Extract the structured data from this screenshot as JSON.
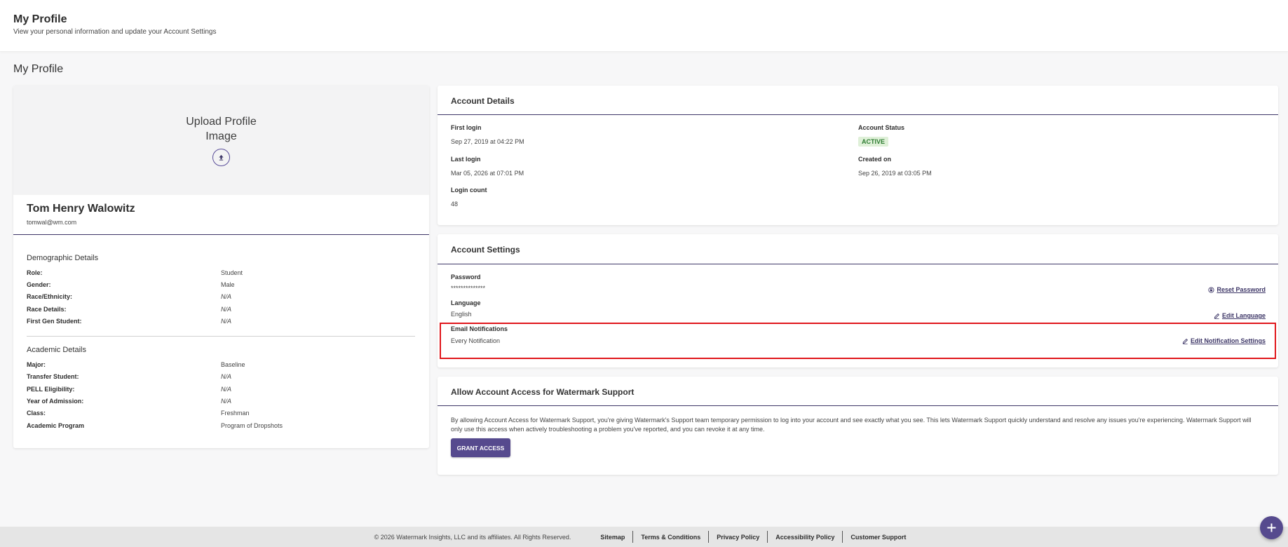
{
  "header": {
    "title": "My Profile",
    "subtitle": "View your personal information and update your Account Settings"
  },
  "page": {
    "title": "My Profile"
  },
  "profile": {
    "upload_line1": "Upload Profile",
    "upload_line2": "Image",
    "upload_icon": "upload-icon",
    "name": "Tom Henry Walowitz",
    "email": "tomwal@wm.com"
  },
  "demographic": {
    "heading": "Demographic Details",
    "rows": [
      {
        "label": "Role:",
        "value": "Student"
      },
      {
        "label": "Gender:",
        "value": "Male"
      },
      {
        "label": "Race/Ethnicity:",
        "value": "N/A"
      },
      {
        "label": "Race Details:",
        "value": "N/A"
      },
      {
        "label": "First Gen Student:",
        "value": "N/A"
      }
    ]
  },
  "academic": {
    "heading": "Academic Details",
    "rows": [
      {
        "label": "Major:",
        "value": "Baseline"
      },
      {
        "label": "Transfer Student:",
        "value": "N/A"
      },
      {
        "label": "PELL Eligibility:",
        "value": "N/A"
      },
      {
        "label": "Year of Admission:",
        "value": "N/A"
      },
      {
        "label": "Class:",
        "value": "Freshman"
      },
      {
        "label": "Academic Program",
        "value": "Program of Dropshots"
      }
    ]
  },
  "account_details": {
    "title": "Account Details",
    "first_login_label": "First login",
    "first_login": "Sep 27, 2019 at 04:22 PM",
    "last_login_label": "Last login",
    "last_login": "Mar 05, 2026 at 07:01 PM",
    "login_count_label": "Login count",
    "login_count": "48",
    "status_label": "Account Status",
    "status": "ACTIVE",
    "created_label": "Created on",
    "created": "Sep 26, 2019 at 03:05 PM"
  },
  "account_settings": {
    "title": "Account Settings",
    "password_label": "Password",
    "password_value": "**************",
    "reset_password": "Reset Password",
    "language_label": "Language",
    "language_value": "English",
    "edit_language": "Edit Language",
    "email_notif_label": "Email Notifications",
    "email_notif_value": "Every Notification",
    "edit_notif": "Edit Notification Settings"
  },
  "support_access": {
    "title": "Allow Account Access for Watermark Support",
    "description": "By allowing Account Access for Watermark Support, you're giving Watermark's Support team temporary permission to log into your account and see exactly what you see. This lets Watermark Support quickly understand and resolve any issues you're experiencing. Watermark Support will only use this access when actively troubleshooting a problem you've reported, and you can revoke it at any time.",
    "button": "GRANT ACCESS"
  },
  "footer": {
    "copyright": "© 2026 Watermark Insights, LLC and its affiliates. All Rights Reserved.",
    "links": [
      "Sitemap",
      "Terms & Conditions",
      "Privacy Policy",
      "Accessibility Policy",
      "Customer Support"
    ]
  },
  "colors": {
    "brand": "#564a8e",
    "rule": "#3c3566",
    "highlight": "#e0161b",
    "active_bg": "#dff0d8",
    "active_text": "#2e7d32"
  }
}
